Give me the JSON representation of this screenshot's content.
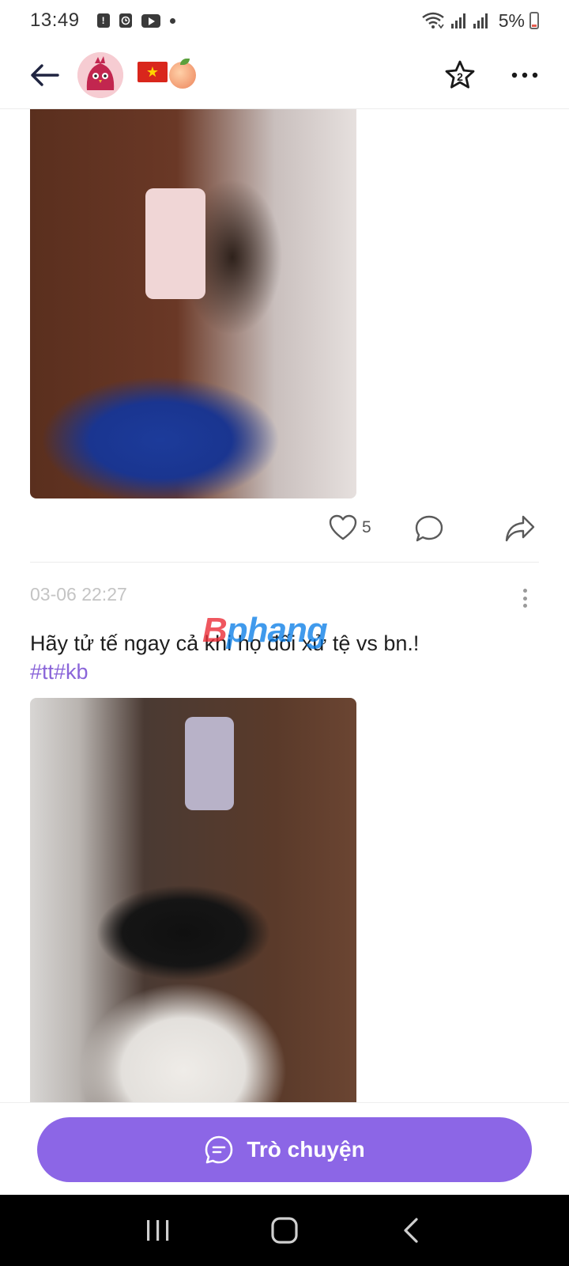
{
  "status_bar": {
    "time": "13:49",
    "notification_icons": [
      "alert-icon",
      "clock-app-icon",
      "youtube-icon",
      "more-dot-icon"
    ],
    "signal_icons": [
      "wifi-icon",
      "signal-icon",
      "signal-icon"
    ],
    "battery": "5%"
  },
  "header": {
    "avatar": "bird-avatar-icon",
    "emoji": [
      "vietnam-flag",
      "peach"
    ],
    "star_badge": "2"
  },
  "post1": {
    "likes": "5"
  },
  "post2": {
    "date": "03-06 22:27",
    "text": "Hãy tử tế ngay cả khi họ đối xử tệ vs bn.!",
    "tags": "#tt#kb"
  },
  "watermark": {
    "first": "B",
    "rest": "phang"
  },
  "chat": {
    "label": "Trò chuyện"
  },
  "colors": {
    "accent": "#8c66e6",
    "tag": "#8a65d9",
    "date": "#c4c4c4"
  }
}
